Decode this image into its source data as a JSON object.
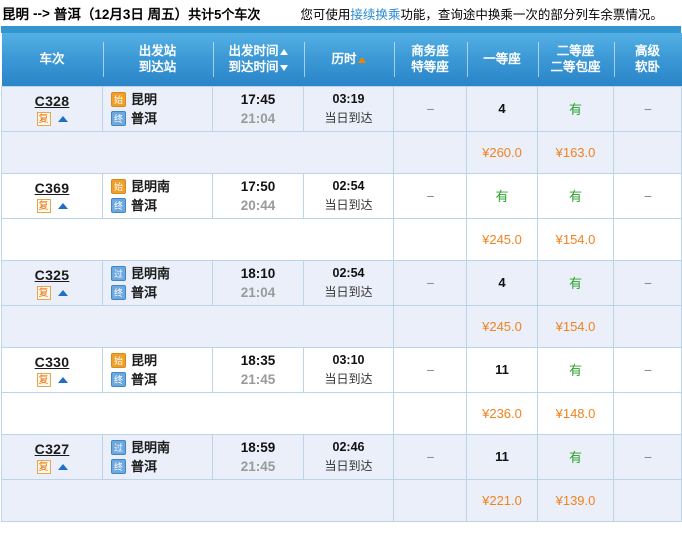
{
  "summary": {
    "from": "昆明",
    "arrow": "-->",
    "to": "普洱",
    "date": "（12月3日  周五）",
    "count_text": "共计5个车次",
    "tip_prefix": "您可使用",
    "tip_link": "接续换乘",
    "tip_suffix": "功能，查询途中换乘一次的部分列车余票情况。"
  },
  "columns": {
    "train": "车次",
    "station_from": "出发站",
    "station_to": "到达站",
    "time_from": "出发时间",
    "time_to": "到达时间",
    "duration": "历时",
    "business_1": "商务座",
    "business_2": "特等座",
    "first_class": "一等座",
    "second_1": "二等座",
    "second_2": "二等包座",
    "soft_sleeper_1": "高级",
    "soft_sleeper_2": "软卧"
  },
  "icons": {
    "start": "始",
    "pass": "过",
    "end": "终",
    "return_badge": "复"
  },
  "colors": {
    "header_blue": "#3d9ad6",
    "link_blue": "#2a8ad4",
    "price_orange": "#f2821e",
    "available_green": "#29a329",
    "row_shade": "#eaeff9",
    "border": "#bcd4e8"
  },
  "arrive_note": "当日到达",
  "none_mark": "--",
  "trains": [
    {
      "code": "C328",
      "shade": true,
      "from_icon": "start",
      "from_station": "昆明",
      "to_icon": "end",
      "to_station": "普洱",
      "depart": "17:45",
      "arrive": "21:04",
      "duration": "03:19",
      "arrive_note": "当日到达",
      "business": "--",
      "first": "4",
      "first_kind": "num",
      "second": "有",
      "second_kind": "yes",
      "sleeper": "--",
      "price_business": "",
      "price_first": "¥260.0",
      "price_second": "¥163.0",
      "price_sleeper": ""
    },
    {
      "code": "C369",
      "shade": false,
      "from_icon": "start",
      "from_station": "昆明南",
      "to_icon": "end",
      "to_station": "普洱",
      "depart": "17:50",
      "arrive": "20:44",
      "duration": "02:54",
      "arrive_note": "当日到达",
      "business": "--",
      "first": "有",
      "first_kind": "yes",
      "second": "有",
      "second_kind": "yes",
      "sleeper": "--",
      "price_business": "",
      "price_first": "¥245.0",
      "price_second": "¥154.0",
      "price_sleeper": ""
    },
    {
      "code": "C325",
      "shade": true,
      "from_icon": "pass",
      "from_station": "昆明南",
      "to_icon": "end",
      "to_station": "普洱",
      "depart": "18:10",
      "arrive": "21:04",
      "duration": "02:54",
      "arrive_note": "当日到达",
      "business": "--",
      "first": "4",
      "first_kind": "num",
      "second": "有",
      "second_kind": "yes",
      "sleeper": "--",
      "price_business": "",
      "price_first": "¥245.0",
      "price_second": "¥154.0",
      "price_sleeper": ""
    },
    {
      "code": "C330",
      "shade": false,
      "from_icon": "start",
      "from_station": "昆明",
      "to_icon": "end",
      "to_station": "普洱",
      "depart": "18:35",
      "arrive": "21:45",
      "duration": "03:10",
      "arrive_note": "当日到达",
      "business": "--",
      "first": "11",
      "first_kind": "num",
      "second": "有",
      "second_kind": "yes",
      "sleeper": "--",
      "price_business": "",
      "price_first": "¥236.0",
      "price_second": "¥148.0",
      "price_sleeper": ""
    },
    {
      "code": "C327",
      "shade": true,
      "from_icon": "pass",
      "from_station": "昆明南",
      "to_icon": "end",
      "to_station": "普洱",
      "depart": "18:59",
      "arrive": "21:45",
      "duration": "02:46",
      "arrive_note": "当日到达",
      "business": "--",
      "first": "11",
      "first_kind": "num",
      "second": "有",
      "second_kind": "yes",
      "sleeper": "--",
      "price_business": "",
      "price_first": "¥221.0",
      "price_second": "¥139.0",
      "price_sleeper": ""
    }
  ]
}
